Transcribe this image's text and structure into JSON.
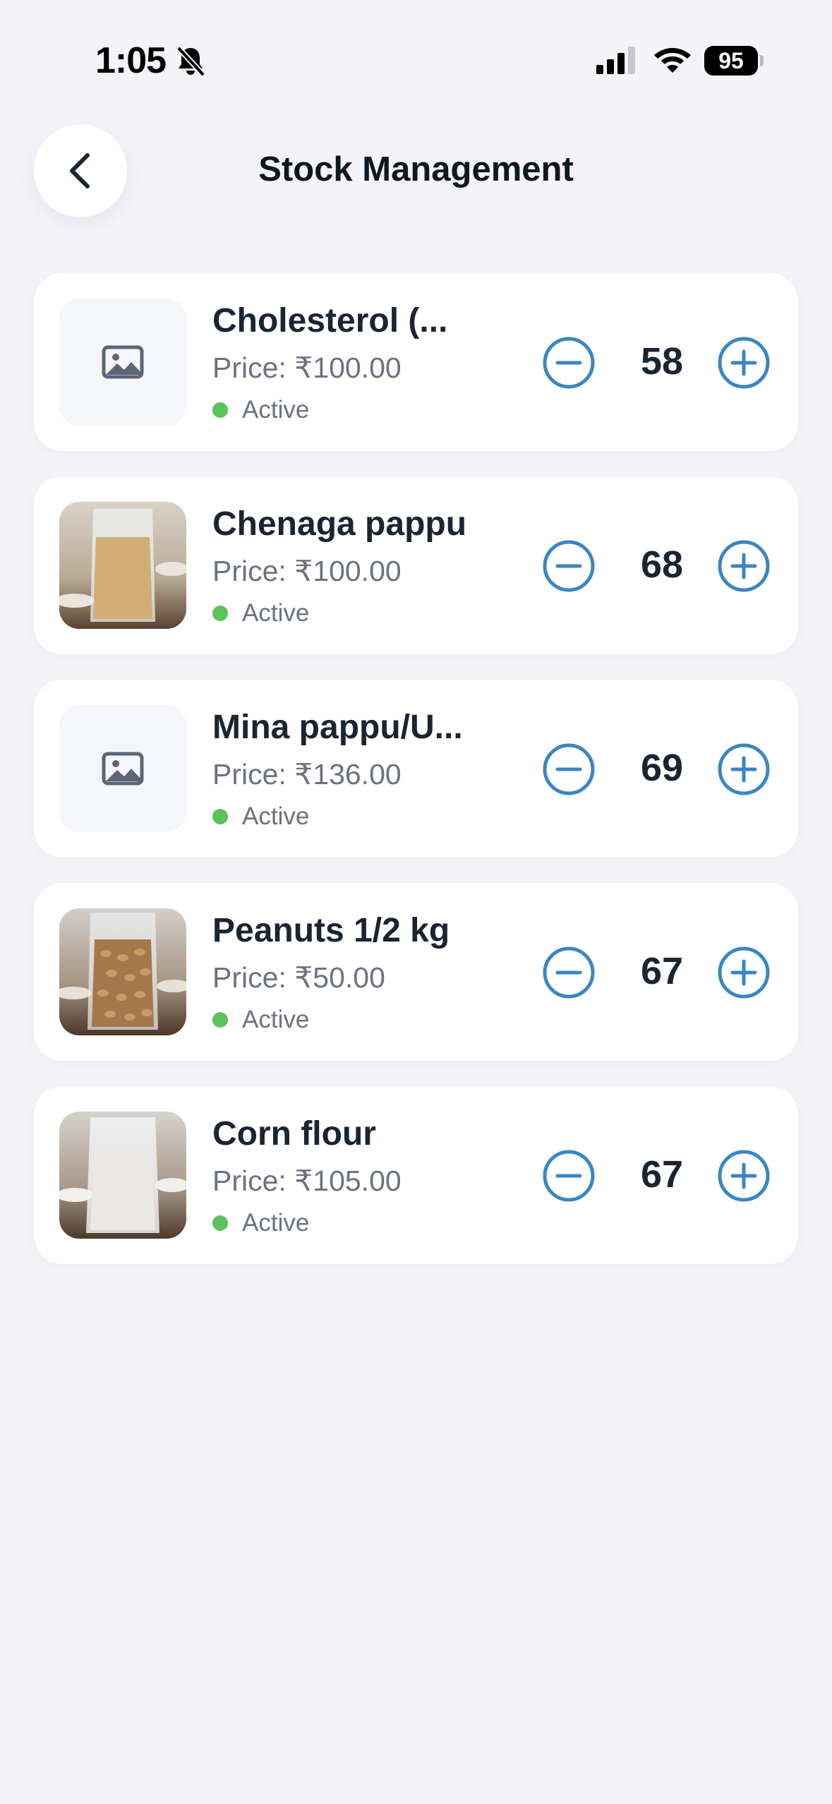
{
  "status_bar": {
    "time": "1:05",
    "battery": "95"
  },
  "header": {
    "title": "Stock Management"
  },
  "products": [
    {
      "name": "Cholesterol (...",
      "price": "Price: ₹100.00",
      "status": "Active",
      "quantity": "58",
      "image": "placeholder-image-icon"
    },
    {
      "name": "Chenaga pappu",
      "price": "Price: ₹100.00",
      "status": "Active",
      "quantity": "68",
      "image": "grain-pouch-photo"
    },
    {
      "name": "Mina pappu/U...",
      "price": "Price: ₹136.00",
      "status": "Active",
      "quantity": "69",
      "image": "placeholder-image-icon"
    },
    {
      "name": "Peanuts 1/2 kg",
      "price": "Price: ₹50.00",
      "status": "Active",
      "quantity": "67",
      "image": "peanut-pouch-photo"
    },
    {
      "name": "Corn flour",
      "price": "Price: ₹105.00",
      "status": "Active",
      "quantity": "67",
      "image": "flour-pouch-photo"
    }
  ],
  "colors": {
    "accent": "#3a86c2",
    "active_dot": "#5ac35a",
    "background": "#f3f3f8"
  }
}
